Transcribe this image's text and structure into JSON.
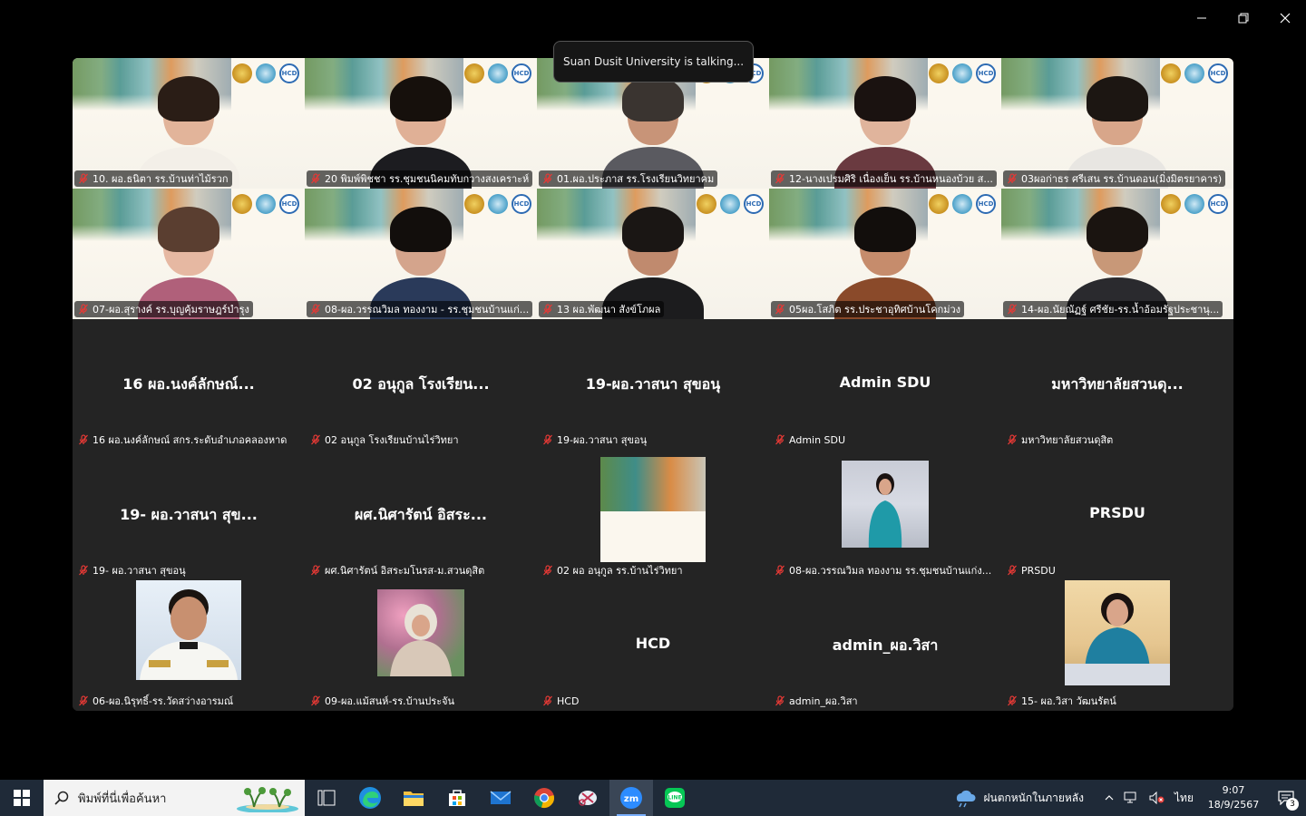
{
  "speaker_notice": "Suan Dusit University is talking...",
  "video_tiles": [
    {
      "label": "10. ผอ.ธนิตา รร.บ้านท่าไม้รวก",
      "skin": "#e2b49a",
      "hair": "#2a1d16",
      "cloth": "#f3efe8"
    },
    {
      "label": "20 พิมพ์พิชชา รร.ชุมชนนิคมทับกวางสงเคราะห์",
      "skin": "#e0b096",
      "hair": "#16100c",
      "cloth": "#1c1c20"
    },
    {
      "label": "01.ผอ.ประภาส รร.โรงเรียนวิทยาคม",
      "skin": "#c89478",
      "hair": "#3a3430",
      "cloth": "#5a5a60"
    },
    {
      "label": "12-นางเปรมศิริ เนื่องเย็น รร.บ้านหนองบ้วย ส...",
      "skin": "#e0b49c",
      "hair": "#1a1210",
      "cloth": "#6a3a40"
    },
    {
      "label": "03ผอก่าธร ศรีเสน รร.บ้านดอน(มิ่งมิตรยาคาร)",
      "skin": "#d8a68a",
      "hair": "#1c1612",
      "cloth": "#e8e6e2"
    },
    {
      "label": "07-ผอ.สุรางค์ รร.บุญคุ้มราษฎร์บำรุง",
      "skin": "#e6b8a2",
      "hair": "#5a3e30",
      "cloth": "#b0607a"
    },
    {
      "label": "08-ผอ.วรรณวิมล ทองงาม - รร.ชุมชนบ้านแก่...",
      "skin": "#d4a48c",
      "hair": "#120e0c",
      "cloth": "#2a3a5a"
    },
    {
      "label": "13 ผอ.พัฒนา สังข์โภผล",
      "skin": "#c08a6e",
      "hair": "#1a1614",
      "cloth": "#1c1c1e"
    },
    {
      "label": "05ผอ.โสภิต รร.ประชาอุทิศบ้านโคกม่วง",
      "skin": "#c68c6c",
      "hair": "#120e0c",
      "cloth": "#8a4a2a"
    },
    {
      "label": "14-ผอ.นัยณัฏฐ์ ศรีชัย-รร.น้ำอ้อมรัฐประชานุ...",
      "skin": "#c89878",
      "hair": "#1a1410",
      "cloth": "#2a2a2e"
    }
  ],
  "name_tiles": [
    {
      "display": "16 ผอ.นงค์ลักษณ์...",
      "label": "16 ผอ.นงค์ลักษณ์ สกร.ระดับอำเภอคลองหาด"
    },
    {
      "display": "02 อนุกูล โรงเรียน...",
      "label": "02 อนุกูล โรงเรียนบ้านไร่วิทยา"
    },
    {
      "display": "19-ผอ.วาสนา สุขอนุ",
      "label": "19-ผอ.วาสนา สุขอนุ"
    },
    {
      "display": "Admin SDU",
      "label": "Admin SDU"
    },
    {
      "display": "มหาวิทยาลัยสวนดุ...",
      "label": "มหาวิทยาลัยสวนดุสิต"
    },
    {
      "display": "19- ผอ.วาสนา สุข...",
      "label": "19- ผอ.วาสนา สุขอนุ"
    },
    {
      "display": "ผศ.นิศารัตน์ อิสระ...",
      "label": "ผศ.นิศารัตน์ อิสระมโนรส-ม.สวนดุสิต"
    },
    {
      "label": "02 ผอ อนุกูล รร.บ้านไร่วิทยา"
    },
    {
      "label": "08-ผอ.วรรณวิมล ทองงาม รร.ชุมชนบ้านแก่ง..."
    },
    {
      "display": "PRSDU",
      "label": "PRSDU"
    },
    {
      "label": "06-ผอ.นิรุทธิ์-รร.วัดสว่างอารมณ์"
    },
    {
      "label": "09-ผอ.แม้สนห์-รร.บ้านประจัน"
    },
    {
      "display": "HCD",
      "label": "HCD"
    },
    {
      "display": "admin_ผอ.วิสา",
      "label": "admin_ผอ.วิสา"
    },
    {
      "label": "15- ผอ.วิสา วัฒนรัตน์"
    }
  ],
  "taskbar": {
    "search_placeholder": "พิมพ์ที่นี่เพื่อค้นหา",
    "weather_text": "ฝนตกหนักในภายหลัง",
    "language": "ไทย",
    "time": "9:07",
    "date": "18/9/2567",
    "notification_count": "3"
  },
  "colors": {
    "gallery_bg": "#242424",
    "taskbar_bg": "#1f2a38",
    "mic_muted": "#e53935",
    "zoom_blue": "#2d8cff",
    "line_green": "#06c755"
  }
}
